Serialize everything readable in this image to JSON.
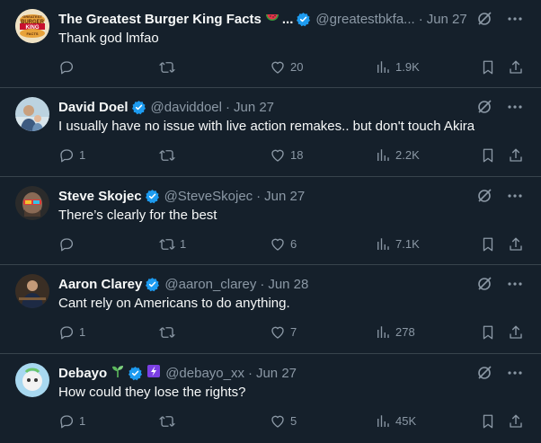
{
  "colors": {
    "background": "#15202b",
    "verified": "#1d9bf0",
    "muted": "#8b98a5",
    "divider": "#38444d"
  },
  "tweets": [
    {
      "name": "The Greatest Burger King Facts",
      "name_suffix": "...",
      "handle": "@greatestbkfa...",
      "date": "Jun 27",
      "text": "Thank god lmfao",
      "avatar_text": [
        "GREATEST",
        "BURGER",
        "KING",
        "FACTS"
      ],
      "replies": "",
      "retweets": "",
      "likes": "20",
      "views": "1.9K"
    },
    {
      "name": "David Doel",
      "handle": "@daviddoel",
      "date": "Jun 27",
      "text": "I usually have no issue with live action remakes.. but don't touch Akira",
      "replies": "1",
      "retweets": "",
      "likes": "18",
      "views": "2.2K"
    },
    {
      "name": "Steve Skojec",
      "handle": "@SteveSkojec",
      "date": "Jun 27",
      "text": "There’s clearly for the best",
      "replies": "",
      "retweets": "1",
      "likes": "6",
      "views": "7.1K"
    },
    {
      "name": "Aaron Clarey",
      "handle": "@aaron_clarey",
      "date": "Jun 28",
      "text": "Cant rely on Americans to do anything.",
      "replies": "1",
      "retweets": "",
      "likes": "7",
      "views": "278"
    },
    {
      "name": "Debayo",
      "handle": "@debayo_xx",
      "date": "Jun 27",
      "text": "How could they lose the rights?",
      "replies": "1",
      "retweets": "",
      "likes": "5",
      "views": "45K"
    }
  ]
}
